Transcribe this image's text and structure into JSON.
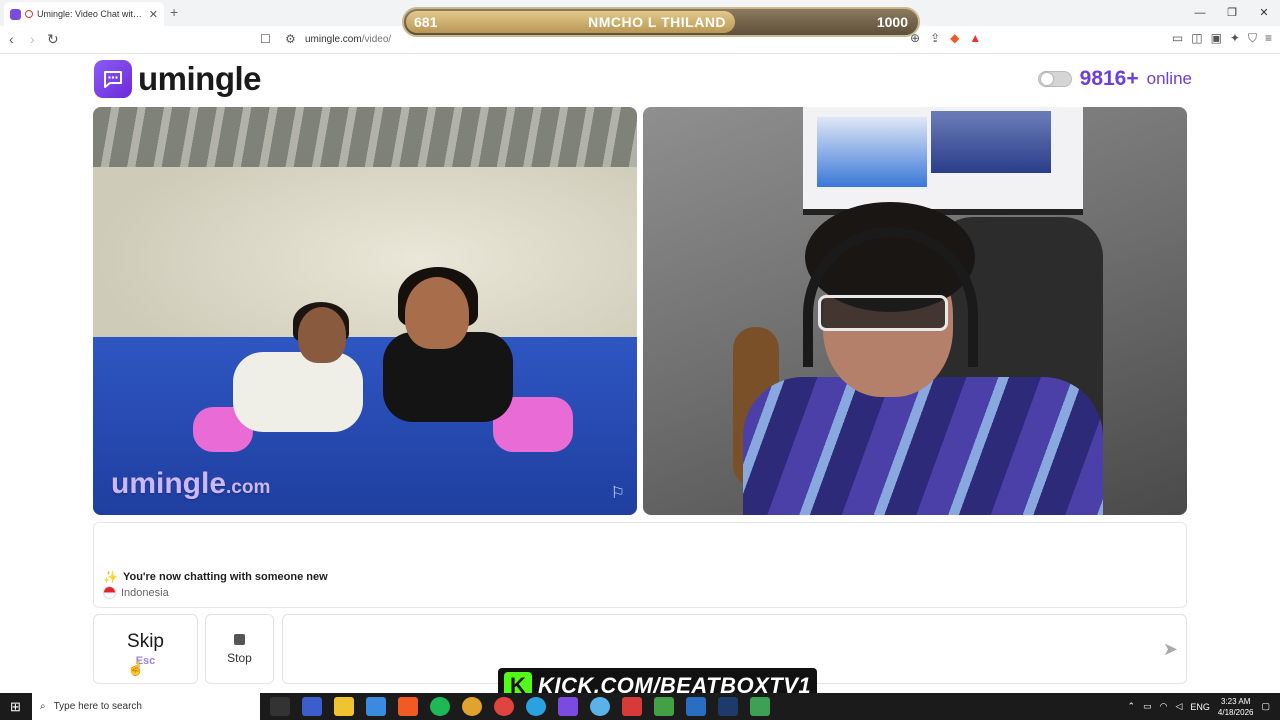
{
  "browser": {
    "tab_title": "Umingle: Video Chat with Stra",
    "url_host": "umingle.com",
    "url_path": "/video/"
  },
  "overlay": {
    "score_left": "681",
    "score_title": "NMCHO L THILAND",
    "score_right": "1000",
    "kick_url": "KICK.COM/BEATBOXTV1"
  },
  "header": {
    "brand": "umingle",
    "online_count": "9816+",
    "online_label": "online"
  },
  "video": {
    "watermark": "umingle",
    "watermark_suffix": ".com"
  },
  "chat": {
    "system_message": "You're now chatting with someone new",
    "country": "Indonesia",
    "message_placeholder": ""
  },
  "controls": {
    "skip_label": "Skip",
    "skip_hint": "Esc",
    "stop_label": "Stop"
  },
  "taskbar": {
    "search_placeholder": "Type here to search",
    "language": "ENG",
    "time": "3:23 AM",
    "date": "4/18/2026"
  },
  "colors": {
    "brand_purple": "#6d3fd6",
    "kick_green": "#53fc18"
  }
}
